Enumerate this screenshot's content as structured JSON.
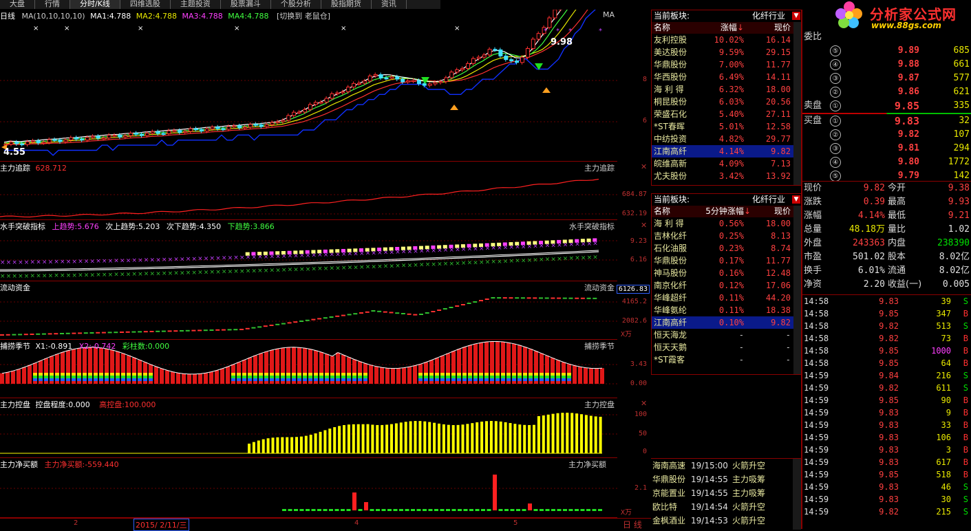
{
  "tabs": [
    "大盘",
    "行情",
    "分时/K线",
    "四维选股",
    "主题投资",
    "股票漏斗",
    "个股分析",
    "股指期货",
    "资讯"
  ],
  "active_tab": 2,
  "logo": {
    "brand": "分析家公式网",
    "url": "www.88gs.com"
  },
  "kline": {
    "title": "日线",
    "ma_label": "MA(10,10,10,10)",
    "ma1": "MA1:4.788",
    "ma2": "MA2:4.788",
    "ma3": "MA3:4.788",
    "ma4": "MA4:4.788",
    "switch": "[切换到 老鼠仓]",
    "right_tag": "MA",
    "high_label": "9.98",
    "low_label": "4.55",
    "scale": [
      "8",
      "6"
    ]
  },
  "panes": {
    "p1": {
      "title": "主力追踪",
      "value": "628.712",
      "right": "主力追踪",
      "scale": [
        "684.87",
        "632.19"
      ]
    },
    "p2": {
      "title": "水手突破指标",
      "up": "上趋势:5.676",
      "sub_up": "次上趋势:5.203",
      "sub_down": "次下趋势:4.350",
      "down": "下趋势:3.866",
      "right": "水手突破指标",
      "scale": [
        "9.23",
        "6.16"
      ]
    },
    "p3": {
      "title": "流动资金",
      "right": "流动资金",
      "scale": [
        "6126.83",
        "4165.2",
        "2082.6",
        "X万"
      ]
    },
    "p4": {
      "title": "捕捞季节",
      "x1": "X1:-0.891",
      "x2": "X2:-0.742",
      "bars": "彩柱数:0.000",
      "right": "捕捞季节",
      "scale": [
        "3.43",
        "0.00"
      ]
    },
    "p5": {
      "title": "主力控盘",
      "degree": "控盘程度:0.000",
      "high": "高控盘:100.000",
      "right": "主力控盘",
      "scale": [
        "100",
        "50",
        "0"
      ]
    },
    "p6": {
      "title": "主力净买额",
      "value": "主力净买额:-559.440",
      "right": "主力净买额",
      "scale": [
        "2.1",
        "X万"
      ]
    }
  },
  "xaxis": {
    "labels": [
      "2",
      "4",
      "5"
    ],
    "date": "2015/ 2/11/三",
    "period": "日 线"
  },
  "sector1": {
    "header_label": "当前板块:",
    "industry": "化纤行业",
    "col_name": "名称",
    "col_chg": "涨幅",
    "col_price": "现价",
    "rows": [
      {
        "name": "友利控股",
        "chg": "10.02%",
        "price": "16.14"
      },
      {
        "name": "美达股份",
        "chg": "9.59%",
        "price": "29.15"
      },
      {
        "name": "华鼎股份",
        "chg": "7.00%",
        "price": "11.77"
      },
      {
        "name": "华西股份",
        "chg": "6.49%",
        "price": "14.11"
      },
      {
        "name": "海 利 得",
        "chg": "6.32%",
        "price": "18.00"
      },
      {
        "name": "桐昆股份",
        "chg": "6.03%",
        "price": "20.56"
      },
      {
        "name": "荣盛石化",
        "chg": "5.40%",
        "price": "27.11"
      },
      {
        "name": "*ST春晖",
        "chg": "5.01%",
        "price": "12.58"
      },
      {
        "name": "中纺投资",
        "chg": "4.82%",
        "price": "29.77"
      },
      {
        "name": "江南高纤",
        "chg": "4.14%",
        "price": "9.82"
      },
      {
        "name": "皖维高新",
        "chg": "4.09%",
        "price": "7.13"
      },
      {
        "name": "尤夫股份",
        "chg": "3.42%",
        "price": "13.92"
      }
    ]
  },
  "sector2": {
    "header_label": "当前板块:",
    "industry": "化纤行业",
    "col_name": "名称",
    "col_chg": "5分钟涨幅",
    "col_price": "现价",
    "rows": [
      {
        "name": "海 利 得",
        "chg": "0.56%",
        "price": "18.00"
      },
      {
        "name": "吉林化纤",
        "chg": "0.25%",
        "price": "8.13"
      },
      {
        "name": "石化油服",
        "chg": "0.23%",
        "price": "8.74"
      },
      {
        "name": "华鼎股份",
        "chg": "0.17%",
        "price": "11.77"
      },
      {
        "name": "神马股份",
        "chg": "0.16%",
        "price": "12.48"
      },
      {
        "name": "南京化纤",
        "chg": "0.12%",
        "price": "17.06"
      },
      {
        "name": "华峰超纤",
        "chg": "0.11%",
        "price": "44.20"
      },
      {
        "name": "华峰氨纶",
        "chg": "0.11%",
        "price": "18.38"
      },
      {
        "name": "江南高纤",
        "chg": "0.10%",
        "price": "9.82"
      },
      {
        "name": "恒天海龙",
        "chg": "-",
        "price": "-"
      },
      {
        "name": "恒天天鹅",
        "chg": "-",
        "price": "-"
      },
      {
        "name": "*ST霞客",
        "chg": "-",
        "price": "-"
      }
    ]
  },
  "alerts": [
    {
      "name": "海南高速",
      "time": "19/15:00",
      "msg": "火箭升空"
    },
    {
      "name": "华鼎股份",
      "time": "19/14:55",
      "msg": "主力吸筹"
    },
    {
      "name": "京能置业",
      "time": "19/14:55",
      "msg": "主力吸筹"
    },
    {
      "name": "欧比特",
      "time": "19/14:54",
      "msg": "火箭升空"
    },
    {
      "name": "金枫酒业",
      "time": "19/14:53",
      "msg": "火箭升空"
    }
  ],
  "order_book": {
    "ratio_label": "委比",
    "sell_label": "卖盘",
    "buy_label": "买盘",
    "sells": [
      {
        "n": "⑤",
        "price": "9.89",
        "vol": "685"
      },
      {
        "n": "④",
        "price": "9.88",
        "vol": "661"
      },
      {
        "n": "③",
        "price": "9.87",
        "vol": "577"
      },
      {
        "n": "②",
        "price": "9.86",
        "vol": "621"
      },
      {
        "n": "①",
        "price": "9.85",
        "vol": "335"
      }
    ],
    "buys": [
      {
        "n": "①",
        "price": "9.83",
        "vol": "32"
      },
      {
        "n": "②",
        "price": "9.82",
        "vol": "107"
      },
      {
        "n": "③",
        "price": "9.81",
        "vol": "294"
      },
      {
        "n": "④",
        "price": "9.80",
        "vol": "1772"
      },
      {
        "n": "⑤",
        "price": "9.79",
        "vol": "142"
      }
    ]
  },
  "quote": [
    {
      "l1": "现价",
      "v1": "9.82",
      "l2": "今开",
      "v2": "9.38"
    },
    {
      "l1": "涨跌",
      "v1": "0.39",
      "l2": "最高",
      "v2": "9.93"
    },
    {
      "l1": "涨幅",
      "v1": "4.14%",
      "l2": "最低",
      "v2": "9.21"
    },
    {
      "l1": "总量",
      "v1": "48.18万",
      "l2": "量比",
      "v2": "1.02"
    },
    {
      "l1": "外盘",
      "v1": "243363",
      "l2": "内盘",
      "v2": "238390"
    },
    {
      "l1": "市盈",
      "v1": "501.02",
      "l2": "股本",
      "v2": "8.02亿"
    },
    {
      "l1": "换手",
      "v1": "6.01%",
      "l2": "流通",
      "v2": "8.02亿"
    },
    {
      "l1": "净资",
      "v1": "2.20",
      "l2": "收益(一)",
      "v2": "0.005"
    }
  ],
  "ticks": [
    {
      "t": "14:58",
      "p": "9.83",
      "v": "39",
      "s": "S"
    },
    {
      "t": "14:58",
      "p": "9.85",
      "v": "347",
      "s": "B"
    },
    {
      "t": "14:58",
      "p": "9.82",
      "v": "513",
      "s": "S"
    },
    {
      "t": "14:58",
      "p": "9.82",
      "v": "73",
      "s": "B"
    },
    {
      "t": "14:58",
      "p": "9.85",
      "v": "1000",
      "s": "B"
    },
    {
      "t": "14:58",
      "p": "9.85",
      "v": "64",
      "s": "B"
    },
    {
      "t": "14:59",
      "p": "9.84",
      "v": "216",
      "s": "S"
    },
    {
      "t": "14:59",
      "p": "9.82",
      "v": "611",
      "s": "S"
    },
    {
      "t": "14:59",
      "p": "9.85",
      "v": "90",
      "s": "B"
    },
    {
      "t": "14:59",
      "p": "9.83",
      "v": "9",
      "s": "B"
    },
    {
      "t": "14:59",
      "p": "9.83",
      "v": "33",
      "s": "B"
    },
    {
      "t": "14:59",
      "p": "9.83",
      "v": "106",
      "s": "B"
    },
    {
      "t": "14:59",
      "p": "9.83",
      "v": "3",
      "s": "B"
    },
    {
      "t": "14:59",
      "p": "9.83",
      "v": "617",
      "s": "B"
    },
    {
      "t": "14:59",
      "p": "9.85",
      "v": "518",
      "s": "B"
    },
    {
      "t": "14:59",
      "p": "9.83",
      "v": "46",
      "s": "S"
    },
    {
      "t": "14:59",
      "p": "9.83",
      "v": "30",
      "s": "S"
    },
    {
      "t": "14:59",
      "p": "9.82",
      "v": "215",
      "s": "S"
    }
  ],
  "colors": {
    "up": "#ff3030",
    "down": "#00e0e0",
    "accent": "#c00000",
    "buy": "#ff3030",
    "sell": "#00d000"
  }
}
